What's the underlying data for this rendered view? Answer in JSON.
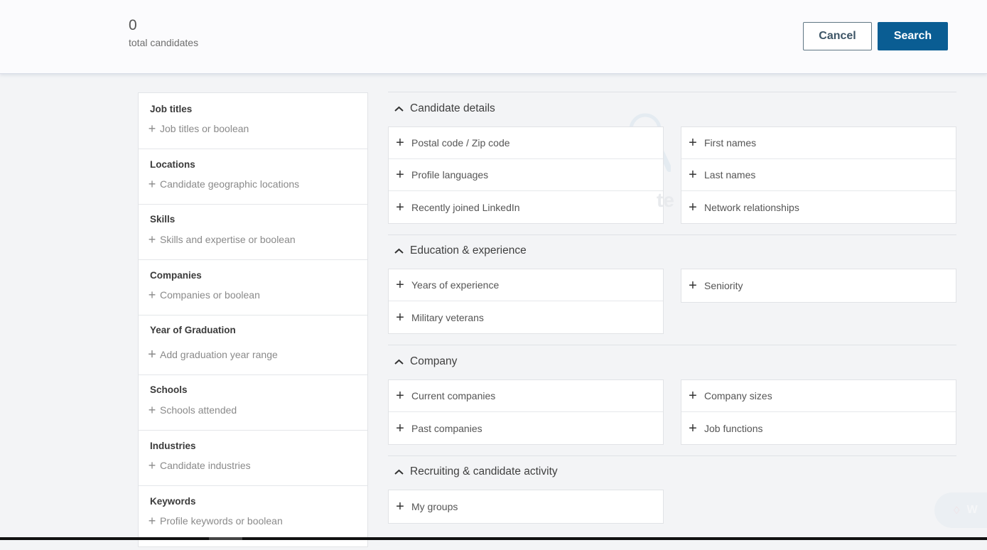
{
  "header": {
    "count": "0",
    "count_label": "total candidates",
    "cancel_label": "Cancel",
    "search_label": "Search"
  },
  "colors": {
    "primary": "#0a5d93",
    "background": "#f3f4f6"
  },
  "filters": [
    {
      "title": "Job titles",
      "placeholder": "Job titles or boolean"
    },
    {
      "title": "Locations",
      "placeholder": "Candidate geographic locations"
    },
    {
      "title": "Skills",
      "placeholder": "Skills and expertise or boolean"
    },
    {
      "title": "Companies",
      "placeholder": "Companies or boolean"
    },
    {
      "title": "Year of Graduation",
      "placeholder": "Add graduation year range"
    },
    {
      "title": "Schools",
      "placeholder": "Schools attended"
    },
    {
      "title": "Industries",
      "placeholder": "Candidate industries"
    },
    {
      "title": "Keywords",
      "placeholder": "Profile keywords or boolean"
    }
  ],
  "sections": [
    {
      "title": "Candidate details",
      "left": [
        "Postal code / Zip code",
        "Profile languages",
        "Recently joined LinkedIn"
      ],
      "right": [
        "First names",
        "Last names",
        "Network relationships"
      ]
    },
    {
      "title": "Education & experience",
      "left": [
        "Years of experience",
        "Military veterans"
      ],
      "right": [
        "Seniority"
      ]
    },
    {
      "title": "Company",
      "left": [
        "Current companies",
        "Past companies"
      ],
      "right": [
        "Company sizes",
        "Job functions"
      ]
    },
    {
      "title": "Recruiting & candidate activity",
      "left": [
        "My groups"
      ],
      "right": []
    }
  ],
  "icons": {
    "add": "+",
    "collapse": "chevron-up"
  },
  "help_bubble": {
    "label": "W"
  }
}
